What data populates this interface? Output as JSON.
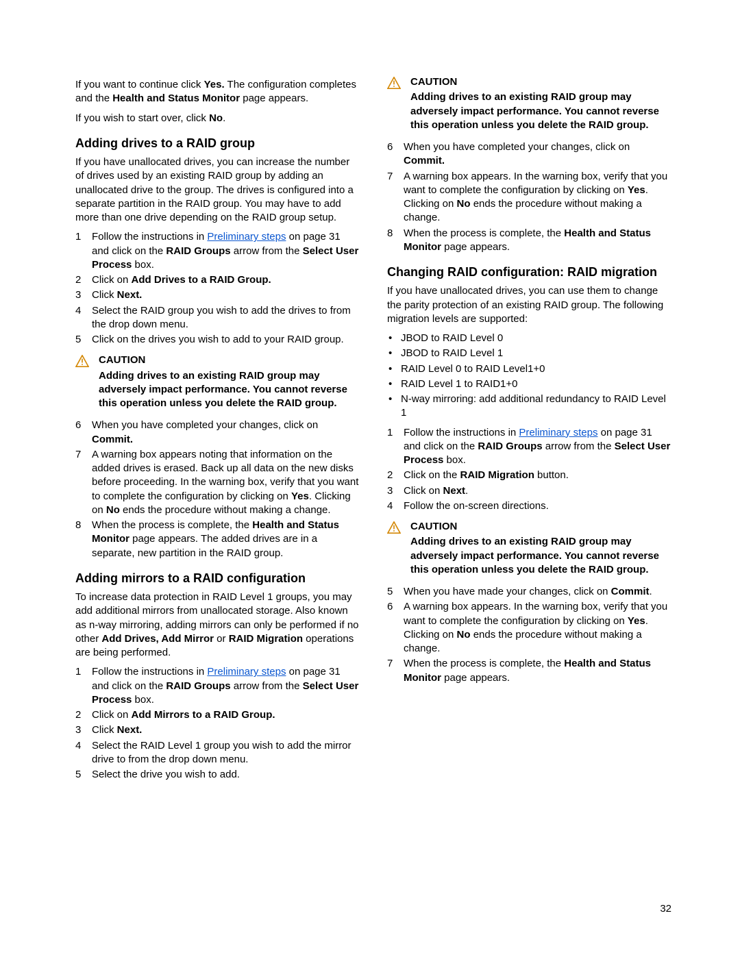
{
  "intro": {
    "para1_pre": "If you want to continue click ",
    "para1_b1": "Yes.",
    "para1_mid": " The configuration completes and the ",
    "para1_b2": "Health and Status Monitor",
    "para1_post": " page appears.",
    "para2_pre": "If you wish to start over, click ",
    "para2_b1": "No",
    "para2_post": "."
  },
  "s1": {
    "heading": "Adding drives to a RAID group",
    "intro": "If you have unallocated drives, you can increase the number of drives used by an existing RAID group by adding an unallocated drive to the group. The drives is configured into a separate partition in the RAID group. You may have to add more than one drive depending on the RAID group setup.",
    "steps": {
      "n1": "1",
      "t1_pre": "Follow the instructions in ",
      "t1_link": "Preliminary steps",
      "t1_mid": " on page 31 and click on the ",
      "t1_b1": "RAID Groups",
      "t1_mid2": " arrow from the ",
      "t1_b2": "Select User Process",
      "t1_post": " box.",
      "n2": "2",
      "t2_pre": "Click on ",
      "t2_b": "Add Drives to a RAID Group.",
      "n3": "3",
      "t3_pre": "Click ",
      "t3_b": "Next.",
      "n4": "4",
      "t4": "Select the RAID group you wish to add the drives to from the drop down menu.",
      "n5": "5",
      "t5": "Click on the drives you wish to add to your RAID group."
    },
    "caution": {
      "title": "CAUTION",
      "msg": "Adding drives to an existing RAID group may adversely impact performance. You cannot reverse this operation unless you delete the RAID group."
    },
    "steps2": {
      "n6": "6",
      "t6_pre": "When you have completed your changes, click on ",
      "t6_b": "Commit.",
      "n7": "7",
      "t7_pre": "A warning box appears noting that information on the added drives is erased. Back up all data on the new disks before proceeding. In the warning box, verify that you want to complete the configuration by clicking on ",
      "t7_b1": "Yes",
      "t7_mid": ". Clicking on ",
      "t7_b2": "No",
      "t7_post": " ends the procedure without making a change.",
      "n8": "8",
      "t8_pre": "When the process is complete, the ",
      "t8_b": "Health and Status Monitor",
      "t8_post": " page appears. The added drives are in a separate, new partition in the RAID group."
    }
  },
  "s2": {
    "heading": "Adding mirrors to a RAID configuration",
    "intro_pre": "To increase data protection in RAID Level 1 groups, you may add additional mirrors from unallocated storage. Also known as n-way mirroring, adding mirrors can only be performed if no other ",
    "intro_b": "Add Drives, Add Mirror",
    "intro_mid": " or ",
    "intro_b2": "RAID Migration",
    "intro_post": " operations are being performed.",
    "steps": {
      "n1": "1",
      "t1_pre": "Follow the instructions in ",
      "t1_link": "Preliminary steps",
      "t1_mid": " on page 31 and click on the ",
      "t1_b1": "RAID Groups",
      "t1_mid2": " arrow from the ",
      "t1_b2": "Select User Process",
      "t1_post": " box.",
      "n2": "2",
      "t2_pre": "Click on ",
      "t2_b": "Add Mirrors to a RAID Group.",
      "n3": "3",
      "t3_pre": "Click ",
      "t3_b": "Next.",
      "n4": "4",
      "t4": "Select the RAID Level 1 group you wish to add the mirror drive to from the drop down menu.",
      "n5": "5",
      "t5": "Select the drive you wish to add."
    },
    "caution": {
      "title": "CAUTION",
      "msg": "Adding drives to an existing RAID group may adversely impact performance. You cannot reverse this operation unless you delete the RAID group."
    },
    "steps2": {
      "n6": "6",
      "t6_pre": "When you have completed your changes, click on ",
      "t6_b": "Commit.",
      "n7": "7",
      "t7_pre": "A warning box appears. In the warning box, verify that you want to complete the configuration by clicking on ",
      "t7_b1": "Yes",
      "t7_mid": ". Clicking on ",
      "t7_b2": "No",
      "t7_post": " ends the procedure without making a change.",
      "n8": "8",
      "t8_pre": "When the process is complete, the ",
      "t8_b": "Health and Status Monitor",
      "t8_post": " page appears."
    }
  },
  "s3": {
    "heading": "Changing RAID configuration: RAID migration",
    "intro": "If you have unallocated drives, you can use them to change the parity protection of an existing RAID group. The following migration levels are supported:",
    "bullets": {
      "b1": "JBOD to RAID Level 0",
      "b2": "JBOD to RAID Level 1",
      "b3": "RAID Level 0 to RAID Level1+0",
      "b4": "RAID Level 1 to RAID1+0",
      "b5": "N-way mirroring: add additional redundancy to RAID Level 1"
    },
    "steps": {
      "n1": "1",
      "t1_pre": "Follow the instructions in ",
      "t1_link": "Preliminary steps",
      "t1_mid": " on page 31 and click on the ",
      "t1_b1": "RAID Groups",
      "t1_mid2": " arrow from the ",
      "t1_b2": "Select User Process",
      "t1_post": " box.",
      "n2": "2",
      "t2_pre": "Click on the ",
      "t2_b": "RAID Migration",
      "t2_post": " button.",
      "n3": "3",
      "t3_pre": "Click on ",
      "t3_b": "Next",
      "t3_post": ".",
      "n4": "4",
      "t4": "Follow the on-screen directions."
    },
    "caution": {
      "title": "CAUTION",
      "msg": "Adding drives to an existing RAID group may adversely impact performance. You cannot reverse this operation unless you delete the RAID group."
    },
    "steps2": {
      "n5": "5",
      "t5_pre": "When you have made your changes, click on ",
      "t5_b": "Commit",
      "t5_post": ".",
      "n6": "6",
      "t6_pre": "A warning box appears. In the warning box, verify that you want to complete the configuration by clicking on ",
      "t6_b1": "Yes",
      "t6_mid": ". Clicking on ",
      "t6_b2": "No",
      "t6_post": " ends the procedure without making a change.",
      "n7": "7",
      "t7_pre": "When the process is complete, the ",
      "t7_b": "Health and Status Monitor",
      "t7_post": " page appears."
    }
  },
  "page_number": "32"
}
